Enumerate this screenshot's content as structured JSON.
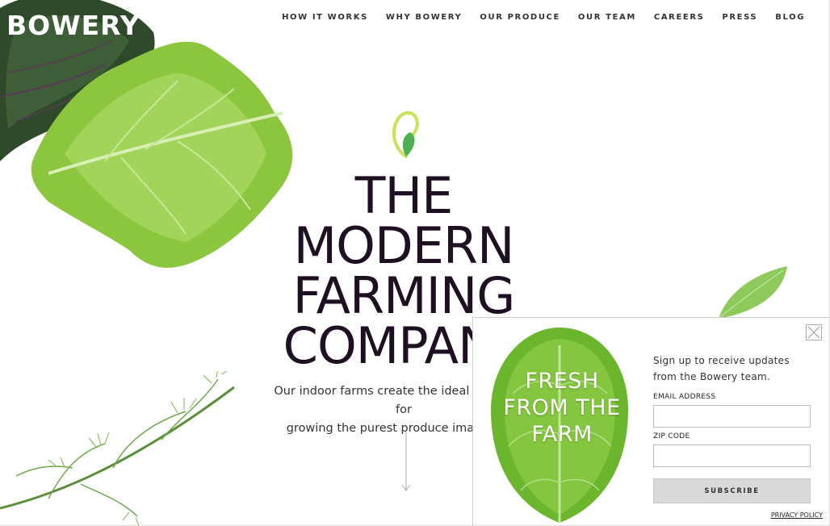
{
  "brand": {
    "logo_text": "BOWERY"
  },
  "nav": {
    "items": [
      "HOW IT WORKS",
      "WHY BOWERY",
      "OUR PRODUCE",
      "OUR TEAM",
      "CAREERS",
      "PRESS",
      "BLOG"
    ]
  },
  "hero": {
    "title_lines": [
      "THE",
      "MODERN",
      "FARMING",
      "COMPANY"
    ],
    "subtitle_lines": [
      "Our indoor farms create the ideal conditions for",
      "growing the purest produce imaginable."
    ]
  },
  "modal": {
    "leaf_text_lines": [
      "FRESH",
      "FROM THE",
      "FARM"
    ],
    "message_lines": [
      "Sign up to receive updates",
      "from the Bowery team."
    ],
    "email_label": "EMAIL ADDRESS",
    "email_value": "",
    "zip_label": "ZIP CODE",
    "zip_value": "",
    "subscribe_label": "SUBSCRIBE",
    "privacy_label": "PRIVACY POLICY"
  },
  "colors": {
    "title": "#1f0f22",
    "leaf_green": "#7cc242",
    "kale_green": "#2f4a2a",
    "button_gray": "#d9d9d9"
  },
  "icons": [
    "seed-logo-icon",
    "down-arrow-icon",
    "close-icon"
  ]
}
